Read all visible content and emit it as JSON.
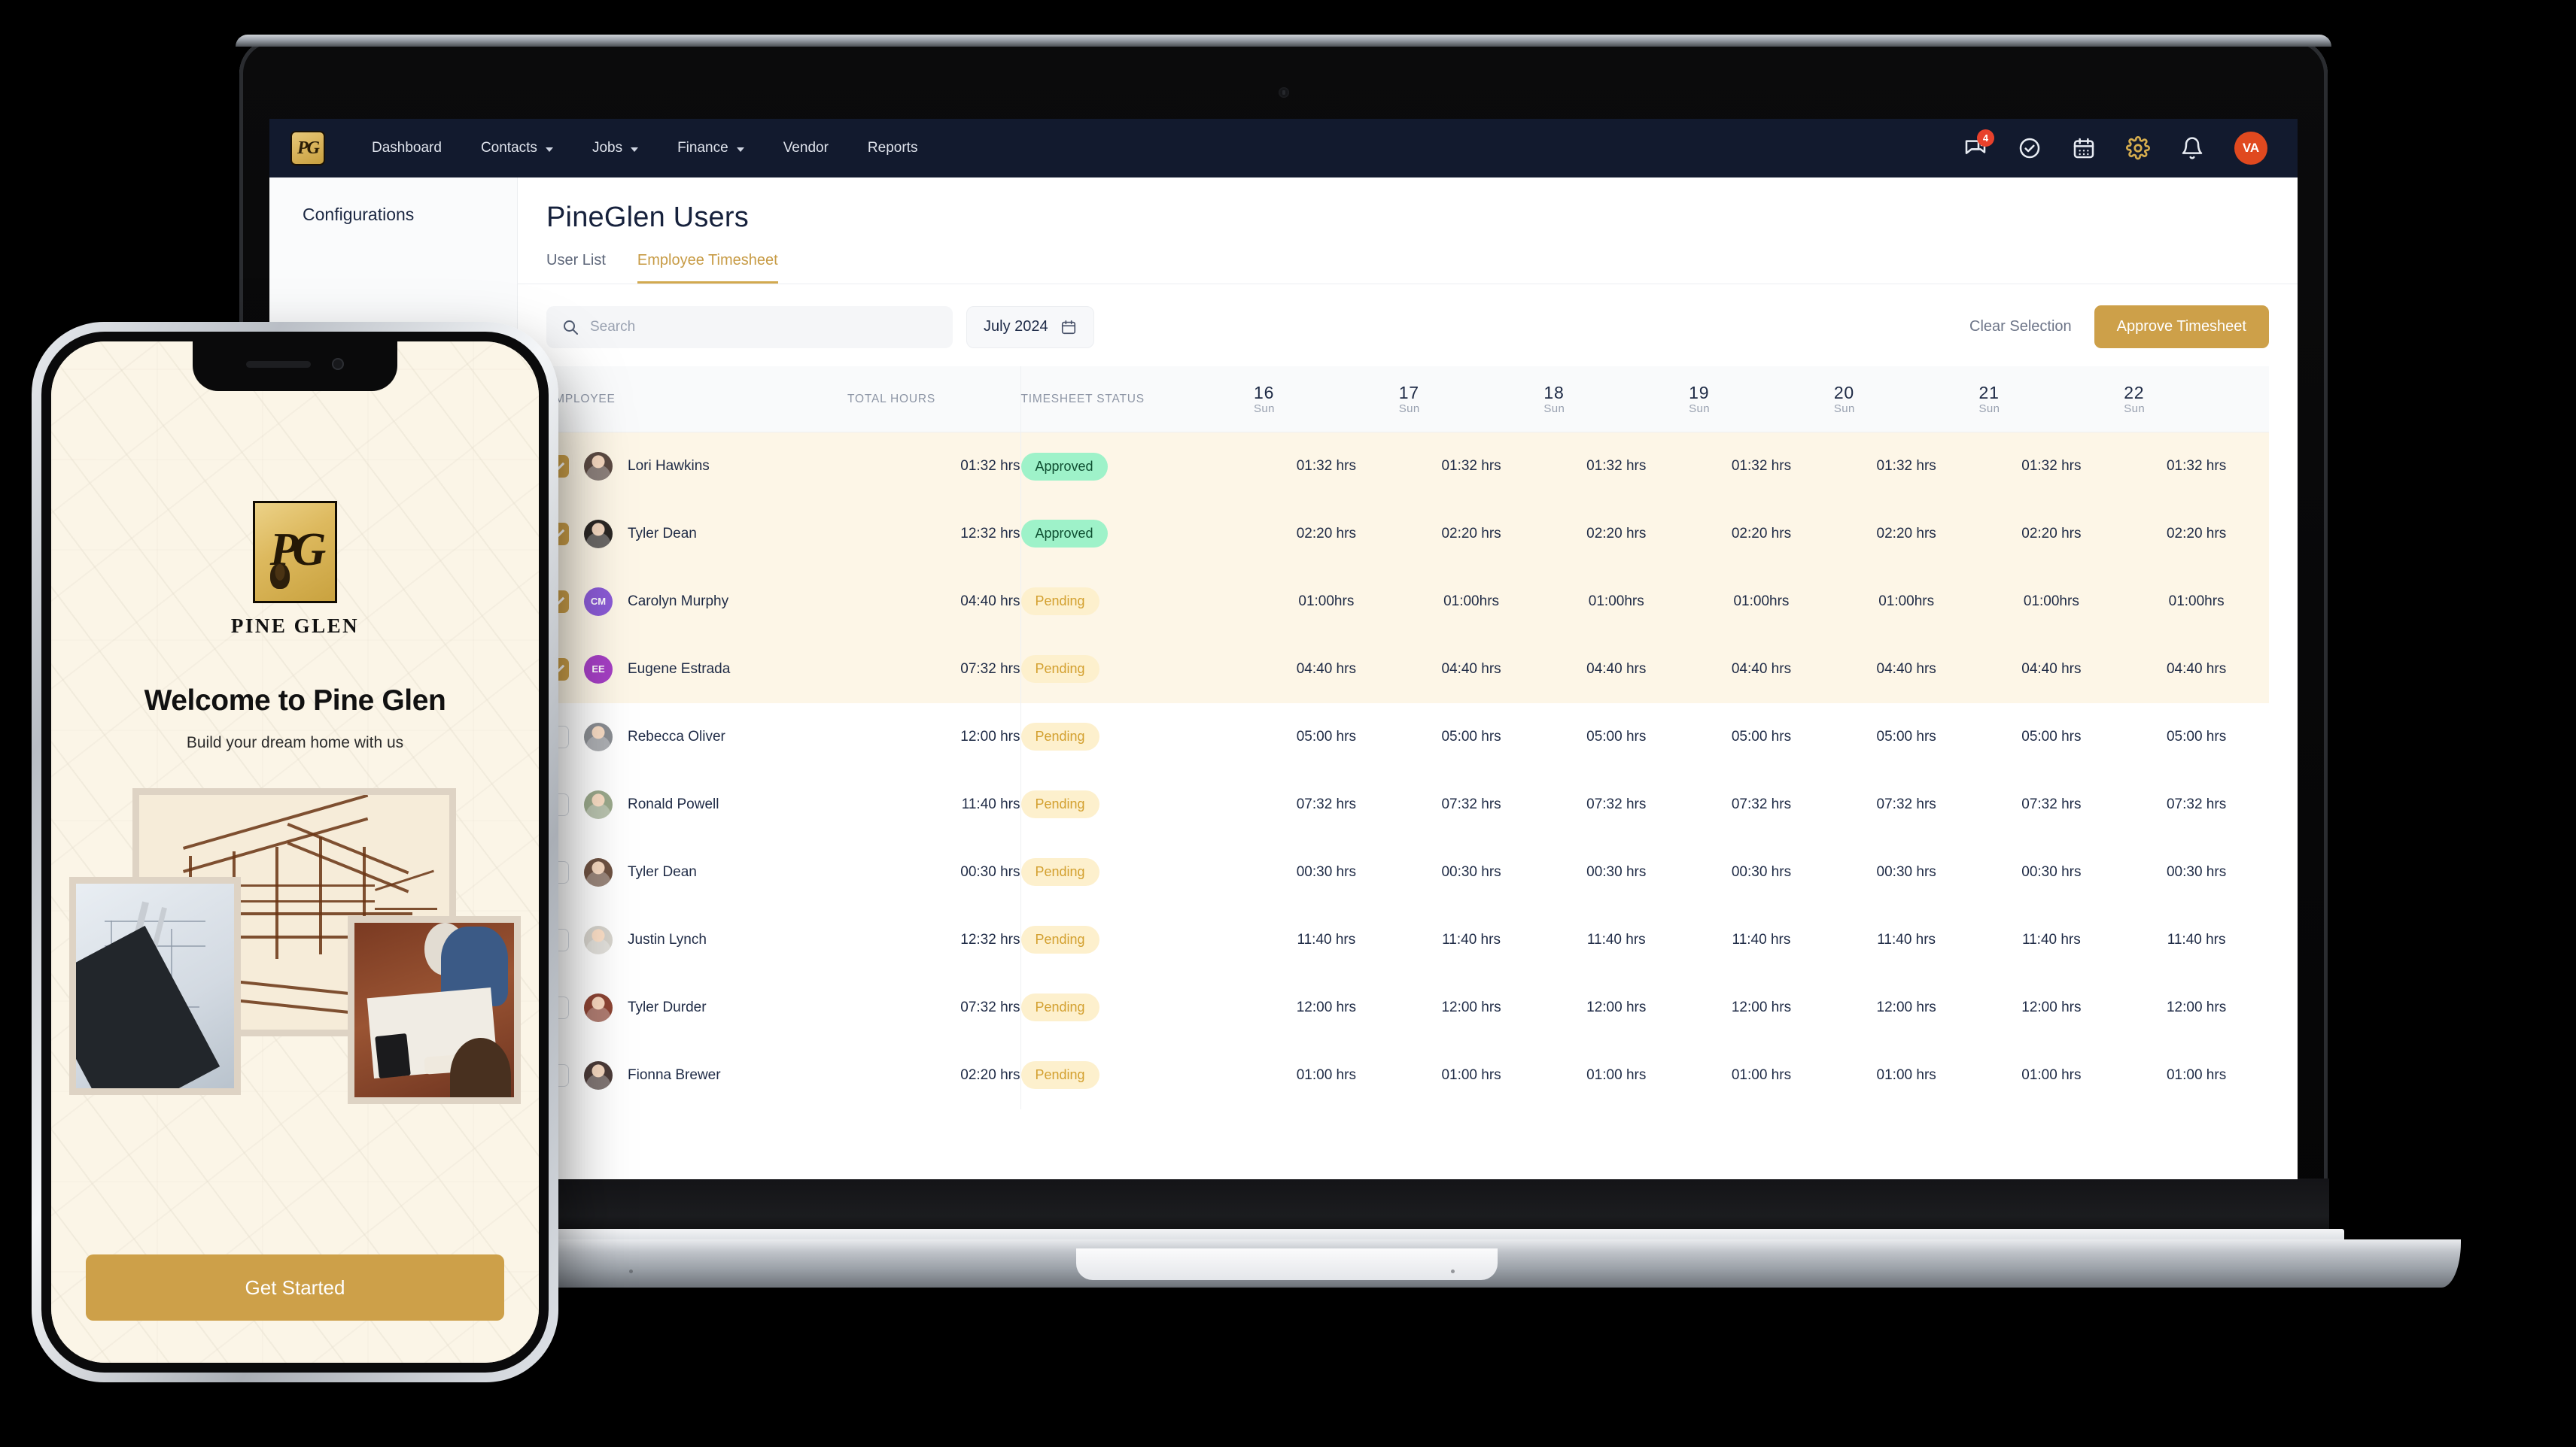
{
  "app": {
    "topnav": {
      "logo_text": "PG",
      "links": [
        {
          "label": "Dashboard",
          "has_caret": false
        },
        {
          "label": "Contacts",
          "has_caret": true
        },
        {
          "label": "Jobs",
          "has_caret": true
        },
        {
          "label": "Finance",
          "has_caret": true
        },
        {
          "label": "Vendor",
          "has_caret": false
        },
        {
          "label": "Reports",
          "has_caret": false
        }
      ],
      "icons": [
        {
          "name": "chat-icon",
          "badge": "4"
        },
        {
          "name": "check-circle-icon",
          "badge": ""
        },
        {
          "name": "calendar-icon",
          "badge": ""
        },
        {
          "name": "gear-icon",
          "badge": ""
        },
        {
          "name": "bell-icon",
          "badge": ""
        }
      ],
      "avatar_initials": "VA",
      "avatar_color": "#e0491f",
      "gear_color": "#d6ad4e",
      "background": "#121a2e"
    },
    "sidebar": {
      "title": "Configurations"
    },
    "page": {
      "title": "PineGlen Users",
      "tabs": [
        {
          "label": "User List",
          "active": false
        },
        {
          "label": "Employee Timesheet",
          "active": true
        }
      ],
      "accent_color": "#cda049"
    },
    "toolbar": {
      "search_placeholder": "Search",
      "search_value": "",
      "month_label": "July 2024",
      "clear_selection_label": "Clear Selection",
      "approve_label": "Approve Timesheet"
    },
    "table": {
      "headers": {
        "employee": "EMPLOYEE",
        "total_hours": "TOTAL HOURS",
        "status": "TIMESHEET STATUS"
      },
      "days": [
        {
          "num": "16",
          "dow": "Sun"
        },
        {
          "num": "17",
          "dow": "Sun"
        },
        {
          "num": "18",
          "dow": "Sun"
        },
        {
          "num": "19",
          "dow": "Sun"
        },
        {
          "num": "20",
          "dow": "Sun"
        },
        {
          "num": "21",
          "dow": "Sun"
        },
        {
          "num": "22",
          "dow": "Sun"
        }
      ],
      "rows": [
        {
          "name": "Lori Hawkins",
          "total": "01:32 hrs",
          "status": "Approved",
          "selected": true,
          "avatar_type": "photo",
          "avatar_color": "#5b4a43",
          "initials": "",
          "hours": [
            "01:32 hrs",
            "01:32 hrs",
            "01:32 hrs",
            "01:32 hrs",
            "01:32 hrs",
            "01:32 hrs",
            "01:32 hrs"
          ]
        },
        {
          "name": "Tyler Dean",
          "total": "12:32 hrs",
          "status": "Approved",
          "selected": true,
          "avatar_type": "photo",
          "avatar_color": "#2b2724",
          "initials": "",
          "hours": [
            "02:20 hrs",
            "02:20 hrs",
            "02:20 hrs",
            "02:20 hrs",
            "02:20 hrs",
            "02:20 hrs",
            "02:20 hrs"
          ]
        },
        {
          "name": "Carolyn Murphy",
          "total": "04:40 hrs",
          "status": "Pending",
          "selected": true,
          "avatar_type": "initials",
          "avatar_color": "#8b5bd6",
          "initials": "CM",
          "hours": [
            "01:00hrs",
            "01:00hrs",
            "01:00hrs",
            "01:00hrs",
            "01:00hrs",
            "01:00hrs",
            "01:00hrs"
          ]
        },
        {
          "name": "Eugene Estrada",
          "total": "07:32 hrs",
          "status": "Pending",
          "selected": true,
          "avatar_type": "initials",
          "avatar_color": "#a53fc4",
          "initials": "EE",
          "hours": [
            "04:40 hrs",
            "04:40 hrs",
            "04:40 hrs",
            "04:40 hrs",
            "04:40 hrs",
            "04:40 hrs",
            "04:40 hrs"
          ]
        },
        {
          "name": "Rebecca Oliver",
          "total": "12:00 hrs",
          "status": "Pending",
          "selected": false,
          "avatar_type": "photo",
          "avatar_color": "#8a8d92",
          "initials": "",
          "hours": [
            "05:00 hrs",
            "05:00 hrs",
            "05:00 hrs",
            "05:00 hrs",
            "05:00 hrs",
            "05:00 hrs",
            "05:00 hrs"
          ]
        },
        {
          "name": "Ronald Powell",
          "total": "11:40 hrs",
          "status": "Pending",
          "selected": false,
          "avatar_type": "photo",
          "avatar_color": "#9ba98c",
          "initials": "",
          "hours": [
            "07:32 hrs",
            "07:32 hrs",
            "07:32 hrs",
            "07:32 hrs",
            "07:32 hrs",
            "07:32 hrs",
            "07:32 hrs"
          ]
        },
        {
          "name": "Tyler Dean",
          "total": "00:30 hrs",
          "status": "Pending",
          "selected": false,
          "avatar_type": "photo",
          "avatar_color": "#6e5242",
          "initials": "",
          "hours": [
            "00:30 hrs",
            "00:30 hrs",
            "00:30 hrs",
            "00:30 hrs",
            "00:30 hrs",
            "00:30 hrs",
            "00:30 hrs"
          ]
        },
        {
          "name": "Justin Lynch",
          "total": "12:32 hrs",
          "status": "Pending",
          "selected": false,
          "avatar_type": "photo",
          "avatar_color": "#d6d3cc",
          "initials": "",
          "hours": [
            "11:40 hrs",
            "11:40 hrs",
            "11:40 hrs",
            "11:40 hrs",
            "11:40 hrs",
            "11:40 hrs",
            "11:40 hrs"
          ]
        },
        {
          "name": "Tyler Durder",
          "total": "07:32 hrs",
          "status": "Pending",
          "selected": false,
          "avatar_type": "photo",
          "avatar_color": "#8c4434",
          "initials": "",
          "hours": [
            "12:00 hrs",
            "12:00 hrs",
            "12:00 hrs",
            "12:00 hrs",
            "12:00 hrs",
            "12:00 hrs",
            "12:00 hrs"
          ]
        },
        {
          "name": "Fionna Brewer",
          "total": "02:20 hrs",
          "status": "Pending",
          "selected": false,
          "avatar_type": "photo",
          "avatar_color": "#4b3b38",
          "initials": "",
          "hours": [
            "01:00 hrs",
            "01:00 hrs",
            "01:00 hrs",
            "01:00 hrs",
            "01:00 hrs",
            "01:00 hrs",
            "01:00 hrs"
          ]
        }
      ]
    }
  },
  "phone": {
    "logo_text": "PG",
    "logo_name": "PINE GLEN",
    "welcome": "Welcome to Pine Glen",
    "subtitle": "Build your dream home with us",
    "cta_label": "Get Started",
    "background": "#fbf5e7",
    "cta_color": "#cda049"
  }
}
